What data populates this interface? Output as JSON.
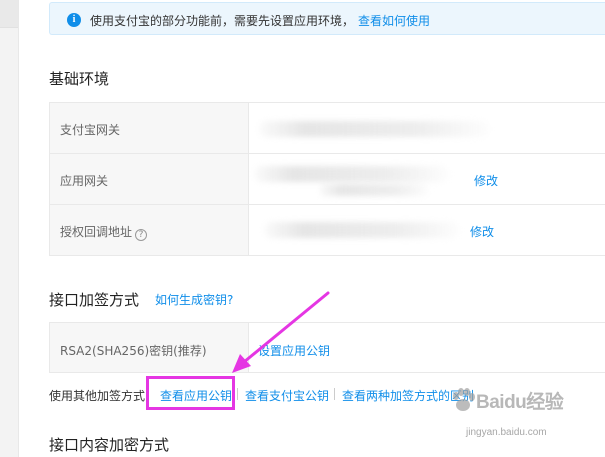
{
  "notice": {
    "icon_glyph": "i",
    "text": "使用支付宝的部分功能前，需要先设置应用环境，",
    "link": "查看如何使用"
  },
  "basic_env": {
    "title": "基础环境",
    "rows": [
      {
        "label": "支付宝网关",
        "action": ""
      },
      {
        "label": "应用网关",
        "action": "修改"
      },
      {
        "label": "授权回调地址",
        "action": "修改",
        "help_icon": "?"
      }
    ]
  },
  "sign_method": {
    "title": "接口加签方式",
    "help_link": "如何生成密钥?",
    "row_label": "RSA2(SHA256)密钥(推荐)",
    "row_action": "设置应用公钥",
    "other_label": "使用其他加签方式",
    "other_links": [
      "查看应用公钥",
      "查看支付宝公钥",
      "查看两种加签方式的区别"
    ]
  },
  "content_encrypt": {
    "title": "接口内容加密方式"
  },
  "watermark": {
    "brand": "Baidu经验",
    "url": "jingyan.baidu.com"
  },
  "colors": {
    "link": "#108ee9",
    "highlight": "#e536e3",
    "notice_bg": "#ecf6fd"
  }
}
